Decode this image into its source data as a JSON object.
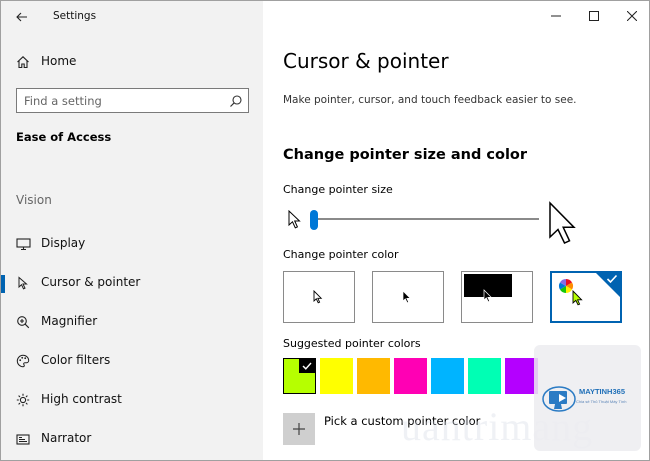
{
  "window": {
    "title": "Settings"
  },
  "sidebar": {
    "home_label": "Home",
    "search_placeholder": "Find a setting",
    "section_title": "Ease of Access",
    "group_label": "Vision",
    "items": [
      {
        "label": "Display",
        "icon": "monitor-icon",
        "selected": false
      },
      {
        "label": "Cursor & pointer",
        "icon": "cursor-pointer-icon",
        "selected": true
      },
      {
        "label": "Magnifier",
        "icon": "magnifier-icon",
        "selected": false
      },
      {
        "label": "Color filters",
        "icon": "color-filters-icon",
        "selected": false
      },
      {
        "label": "High contrast",
        "icon": "high-contrast-icon",
        "selected": false
      },
      {
        "label": "Narrator",
        "icon": "narrator-icon",
        "selected": false
      }
    ]
  },
  "main": {
    "title": "Cursor & pointer",
    "description": "Make pointer, cursor, and touch feedback easier to see.",
    "section_heading": "Change pointer size and color",
    "pointer_size": {
      "label": "Change pointer size",
      "value_fraction": 0.0
    },
    "pointer_color": {
      "label": "Change pointer color",
      "options": [
        "white",
        "black",
        "inverted",
        "custom"
      ],
      "selected": "custom"
    },
    "suggested": {
      "label": "Suggested pointer colors",
      "colors": [
        "#b6ff00",
        "#ffff00",
        "#ffb900",
        "#ff00b4",
        "#00b4ff",
        "#00ffb4",
        "#b400ff"
      ],
      "selected_index": 0
    },
    "custom_color_label": "Pick a custom pointer color"
  },
  "colors": {
    "accent": "#0078d7",
    "selected_border": "#0063b1",
    "sidebar_bg": "#f2f2f2"
  },
  "watermark": {
    "brand": "MAYTINH365",
    "tagline": "Chia sẻ Thủ Thuật Máy Tính",
    "text": "uantrimang"
  }
}
